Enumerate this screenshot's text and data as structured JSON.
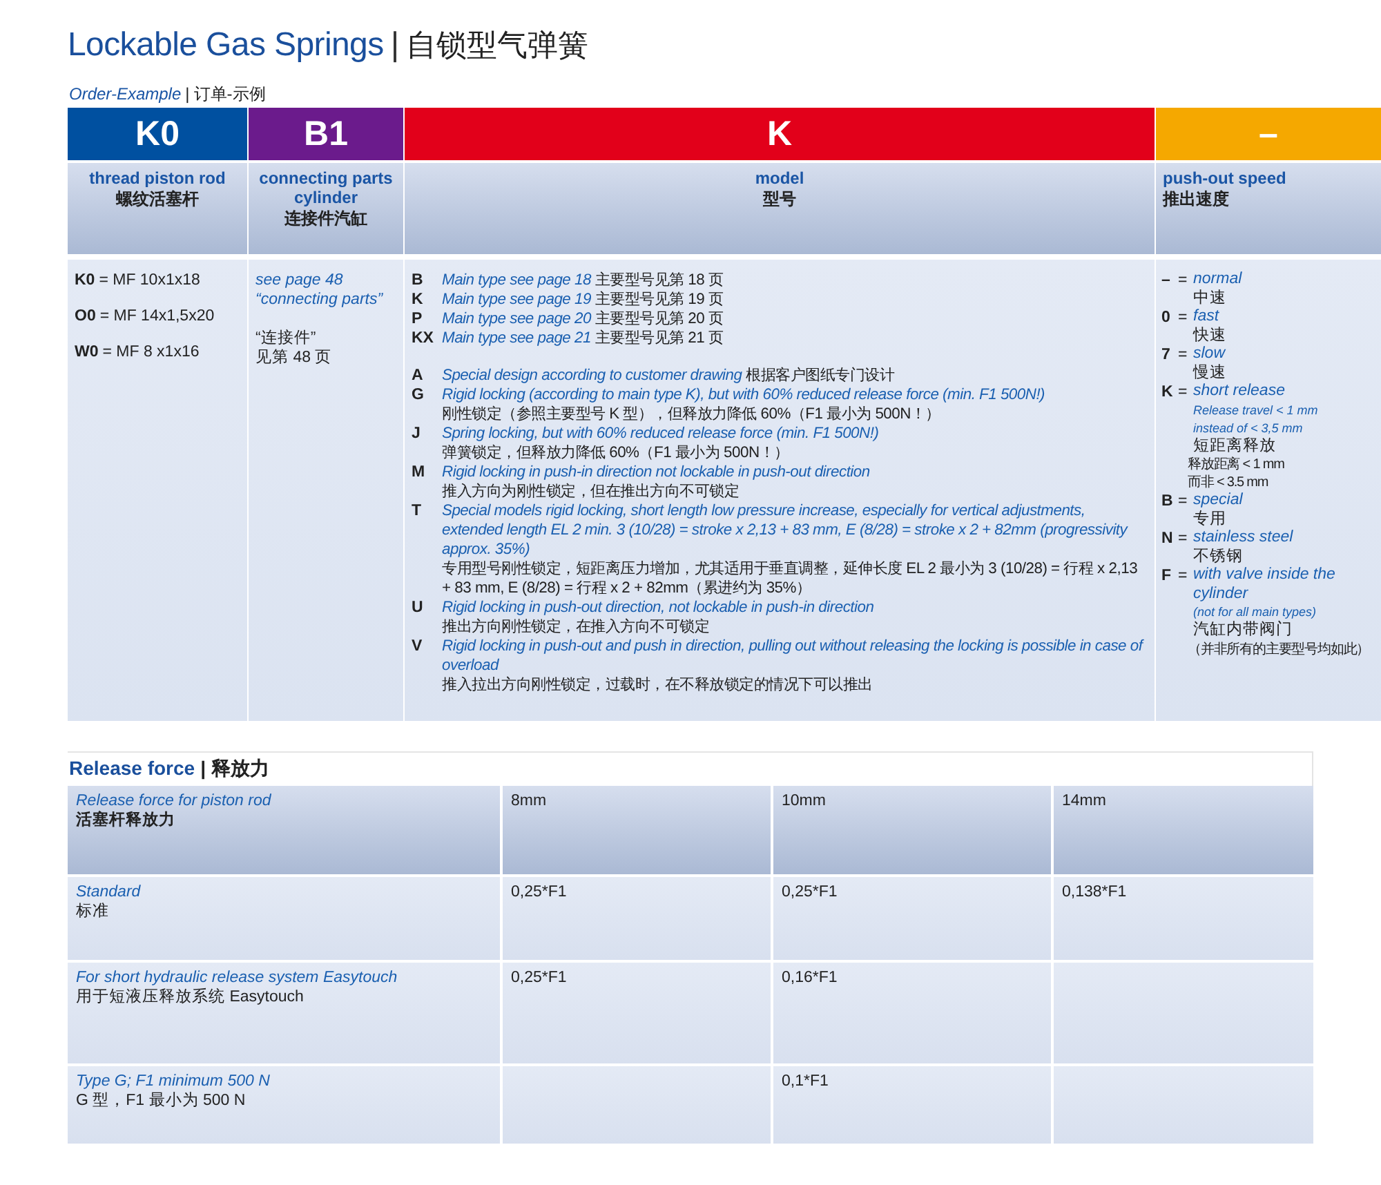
{
  "title": {
    "en": "Lockable Gas Springs",
    "separator": "|",
    "zh": "自锁型气弹簧"
  },
  "order_example": {
    "en": "Order-Example",
    "separator": "|",
    "zh": "订单-示例"
  },
  "order_columns": [
    {
      "code": "K0",
      "color": "#0050a0",
      "heading_en": "thread piston rod",
      "heading_zh": "螺纹活塞杆",
      "kind": "assignments",
      "items": [
        {
          "code": "K0",
          "text": "= MF 10x1x18"
        },
        {
          "code": "O0",
          "text": "= MF 14x1,5x20"
        },
        {
          "code": "W0",
          "text": "= MF 8 x1x16"
        }
      ]
    },
    {
      "code": "B1",
      "color": "#6b1b8c",
      "heading_en": "connecting parts cylinder",
      "heading_zh": "连接件汽缸",
      "kind": "reference",
      "en": [
        "see page 48",
        "“connecting parts”"
      ],
      "zh": [
        "“连接件”",
        "见第 48 页"
      ]
    },
    {
      "code": "K",
      "color": "#e2001a",
      "heading_en": "model",
      "heading_zh": "型号",
      "kind": "models",
      "groups": [
        [
          {
            "code": "B",
            "en": "Main type see page 18",
            "zh": "主要型号见第 18 页",
            "inline": true
          },
          {
            "code": "K",
            "en": "Main type see page 19",
            "zh": "主要型号见第 19 页",
            "inline": true
          },
          {
            "code": "P",
            "en": "Main type see page 20",
            "zh": "主要型号见第 20 页",
            "inline": true
          },
          {
            "code": "KX",
            "en": "Main type see page 21",
            "zh": "主要型号见第 21 页",
            "inline": true
          }
        ],
        [
          {
            "code": "A",
            "en": "Special design according to customer drawing",
            "zh": "根据客户图纸专门设计",
            "inline": true
          },
          {
            "code": "G",
            "en": "Rigid locking (according to main type K), but with 60% reduced release force (min. F1 500N!)",
            "zh": "刚性锁定（参照主要型号 K 型），但释放力降低 60%（F1 最小为 500N！）",
            "inline": false
          },
          {
            "code": "J",
            "en": "Spring locking, but with 60% reduced release force (min. F1 500N!)",
            "zh": "弹簧锁定，但释放力降低 60%（F1 最小为 500N！）",
            "inline": false
          },
          {
            "code": "M",
            "en": "Rigid locking in push-in direction not lockable in push-out direction",
            "zh": "推入方向为刚性锁定，但在推出方向不可锁定",
            "inline": false
          },
          {
            "code": "T",
            "en": "Special models rigid locking, short length low pressure increase, especially for vertical adjustments, extended length EL 2 min. 3 (10/28) = stroke x 2,13 + 83 mm, E (8/28) = stroke x 2 + 82mm (progressivity approx. 35%)",
            "zh": "专用型号刚性锁定，短距离压力增加，尤其适用于垂直调整，延伸长度 EL 2 最小为 3 (10/28) = 行程 x 2,13 + 83 mm, E (8/28) = 行程 x 2 + 82mm（累进约为 35%）",
            "inline": false
          },
          {
            "code": "U",
            "en": "Rigid locking in push-out direction, not lockable in push-in direction",
            "zh": "推出方向刚性锁定，在推入方向不可锁定",
            "inline": false
          },
          {
            "code": "V",
            "en": "Rigid locking in push-out and push in direction, pulling out without releasing the locking is possible in case of overload",
            "zh": "推入拉出方向刚性锁定，过载时，在不释放锁定的情况下可以推出",
            "inline": false
          }
        ]
      ]
    },
    {
      "code": "–",
      "color": "#f5a800",
      "heading_en": "push-out speed",
      "heading_zh": "推出速度",
      "kind": "speeds",
      "items": [
        {
          "code": "–",
          "sign": "=",
          "en": "normal",
          "zh": "中速"
        },
        {
          "code": "0",
          "sign": "=",
          "en": "fast",
          "zh": "快速"
        },
        {
          "code": "7",
          "sign": "=",
          "en": "slow",
          "zh": "慢速"
        },
        {
          "code": "K",
          "sign": "=",
          "en": "short release",
          "note_en": [
            "Release travel < 1 mm",
            "instead of < 3,5 mm"
          ],
          "zh": "短距离释放",
          "note_zh": [
            "释放距离 < 1 mm",
            "而非 < 3.5 mm"
          ]
        },
        {
          "code": "B",
          "sign": "=",
          "en": "special",
          "zh": "专用"
        },
        {
          "code": "N",
          "sign": "=",
          "en": "stainless steel",
          "zh": "不锈钢"
        },
        {
          "code": "F",
          "sign": "=",
          "en": "with valve inside the cylinder",
          "note_en": [
            "(not for all main types)"
          ],
          "zh": "汽缸内带阀门",
          "note_zh": [
            "（并非所有的主要型号均如此）"
          ]
        }
      ]
    }
  ],
  "release_force": {
    "title": {
      "en": "Release force",
      "separator": "|",
      "zh": "释放力"
    },
    "header": {
      "en": "Release force for piston rod",
      "zh": "活塞杆释放力",
      "columns": [
        "8mm",
        "10mm",
        "14mm"
      ]
    },
    "rows": [
      {
        "en": "Standard",
        "zh": "标准",
        "values": {
          "column_1": "0,25*F1",
          "column_2": "0,25*F1",
          "column_3": "0,138*F1"
        }
      },
      {
        "en": "For short hydraulic release system Easytouch",
        "zh": "用于短液压释放系统 Easytouch",
        "values": {
          "column_1": "0,25*F1",
          "column_2": "0,16*F1"
        }
      },
      {
        "en": "Type G; F1 minimum 500 N",
        "zh": "G 型，F1 最小为 500 N",
        "values": {
          "column_2": "0,1*F1"
        }
      }
    ]
  }
}
